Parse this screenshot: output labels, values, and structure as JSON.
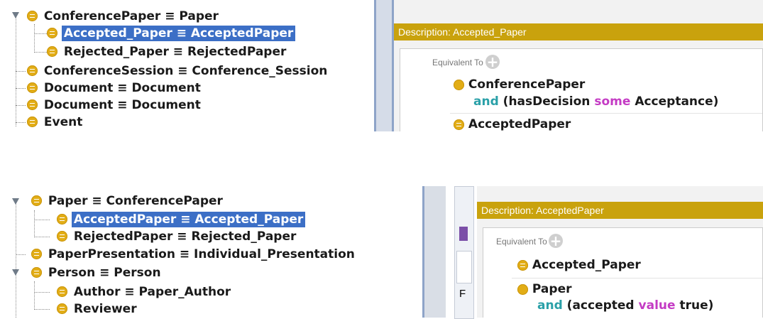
{
  "top": {
    "tree": [
      {
        "label": "ConferencePaper ≡ Paper",
        "expanded": true
      },
      {
        "label": "Accepted_Paper ≡ AcceptedPaper",
        "selected": true
      },
      {
        "label": "Rejected_Paper ≡ RejectedPaper"
      },
      {
        "label": "ConferenceSession ≡ Conference_Session"
      },
      {
        "label": "Document ≡ Document"
      },
      {
        "label": "Document ≡ Document"
      },
      {
        "label": "Event"
      }
    ],
    "description": {
      "header": "Description: Accepted_Paper",
      "equivalent_label": "Equivalent To",
      "add_symbol": "+",
      "expr1_class": "ConferencePaper",
      "expr1_and": "and",
      "expr1_open": "(hasDecision",
      "expr1_some": "some",
      "expr1_close": "Acceptance)",
      "expr2_class": "AcceptedPaper"
    }
  },
  "bottom": {
    "tree": [
      {
        "label": "Paper ≡ ConferencePaper",
        "expanded": true
      },
      {
        "label": "AcceptedPaper ≡ Accepted_Paper",
        "selected": true
      },
      {
        "label": "RejectedPaper ≡ Rejected_Paper"
      },
      {
        "label": "PaperPresentation ≡ Individual_Presentation"
      },
      {
        "label": "Person ≡ Person",
        "expanded": true
      },
      {
        "label": "Author ≡ Paper_Author"
      },
      {
        "label": "Reviewer"
      }
    ],
    "strip_letter": "F",
    "description": {
      "header": "Description: AcceptedPaper",
      "equivalent_label": "Equivalent To",
      "add_symbol": "+",
      "expr1_class": "Accepted_Paper",
      "expr2_class": "Paper",
      "expr2_and": "and",
      "expr2_open": "(accepted",
      "expr2_value": "value",
      "expr2_close": "true)"
    }
  },
  "colors": {
    "class_icon": "#e2ad16",
    "selection": "#3c6fc6",
    "header": "#c9a20d",
    "keyword_and": "#2aa0a8",
    "keyword_some_value": "#c43bc4"
  }
}
